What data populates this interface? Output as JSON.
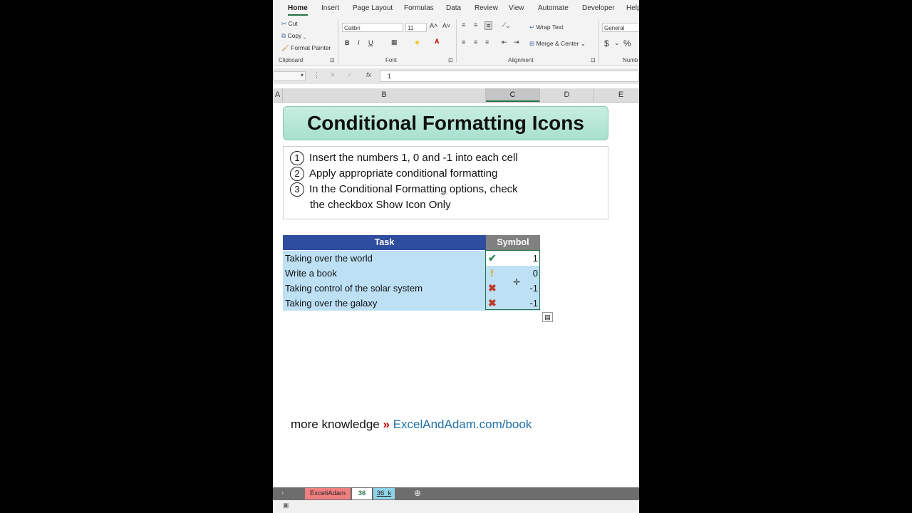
{
  "ribbon_tabs": [
    "Home",
    "Insert",
    "Page Layout",
    "Formulas",
    "Data",
    "Review",
    "View",
    "Automate",
    "Developer",
    "Help"
  ],
  "clipboard": {
    "cut": "Cut",
    "copy": "Copy",
    "format_painter": "Format Painter",
    "group": "Clipboard"
  },
  "font": {
    "name": "Calibri",
    "size": "11",
    "group": "Font",
    "bold": "B",
    "italic": "I",
    "underline": "U",
    "grow": "A˄",
    "shrink": "A˅"
  },
  "alignment": {
    "wrap_text": "Wrap Text",
    "merge_center": "Merge & Center",
    "group": "Alignment"
  },
  "number": {
    "format": "General",
    "currency": "$",
    "percent": "%",
    "group": "Numb"
  },
  "formula_bar": {
    "fx": "fx",
    "value": "1"
  },
  "columns": [
    "A",
    "B",
    "C",
    "D",
    "E"
  ],
  "title": "Conditional Formatting Icons",
  "steps": [
    {
      "num": "1",
      "text": "Insert the numbers 1, 0 and -1 into each cell"
    },
    {
      "num": "2",
      "text": "Apply appropriate conditional formatting"
    },
    {
      "num": "3",
      "text": "In the Conditional Formatting options, check"
    },
    {
      "num": "",
      "text": "the checkbox Show Icon Only"
    }
  ],
  "table": {
    "headers": {
      "task": "Task",
      "symbol": "Symbol"
    },
    "rows": [
      {
        "task": "Taking over the world",
        "value": "1",
        "icon": "check-icon"
      },
      {
        "task": "Write a book",
        "value": "0",
        "icon": "exclamation-icon"
      },
      {
        "task": "Taking control of the solar system",
        "value": "-1",
        "icon": "cross-icon"
      },
      {
        "task": "Taking over the galaxy",
        "value": "-1",
        "icon": "cross-icon"
      }
    ],
    "colors": {
      "task_header": "#2f4d9e",
      "symbol_header": "#808080",
      "row_fill": "#bde0f5"
    }
  },
  "footer": {
    "prefix": "more knowledge",
    "arrow": "»",
    "link": "ExcelAndAdam.com/book"
  },
  "sheet_tabs": [
    {
      "label": "ExceliAdam",
      "color": "#f08080"
    },
    {
      "label": "36",
      "color": "#ffffff"
    },
    {
      "label": "36_k",
      "color": "#8fd3e8"
    }
  ]
}
